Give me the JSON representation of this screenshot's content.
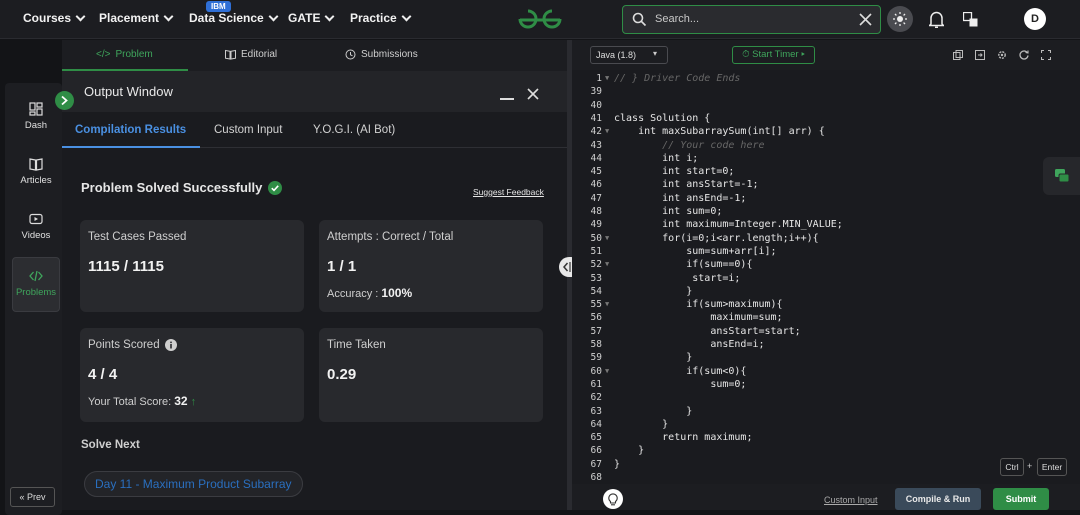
{
  "nav": {
    "items": [
      {
        "label": "Courses"
      },
      {
        "label": "Placement"
      },
      {
        "label": "Data Science"
      },
      {
        "label": "GATE"
      },
      {
        "label": "Practice"
      }
    ],
    "ibm_badge": "IBM",
    "search_placeholder": "Search...",
    "avatar_letter": "D"
  },
  "rail": {
    "items": [
      {
        "label": "Dash",
        "icon": "dashboard-icon"
      },
      {
        "label": "Articles",
        "icon": "book-icon"
      },
      {
        "label": "Videos",
        "icon": "video-icon"
      },
      {
        "label": "Problems",
        "icon": "code-icon"
      }
    ],
    "prev_label": "Prev"
  },
  "problem_tabs": [
    {
      "label": "Problem"
    },
    {
      "label": "Editorial"
    },
    {
      "label": "Submissions"
    }
  ],
  "output": {
    "title": "Output Window",
    "tabs": [
      {
        "label": "Compilation Results"
      },
      {
        "label": "Custom Input"
      },
      {
        "label": "Y.O.G.I. (AI Bot)"
      }
    ],
    "status": "Problem Solved Successfully",
    "feedback_link": "Suggest Feedback",
    "cards": {
      "test_cases": {
        "label": "Test Cases Passed",
        "value": "1115 / 1115"
      },
      "attempts": {
        "label": "Attempts : Correct / Total",
        "value": "1 / 1",
        "accuracy_label": "Accuracy :",
        "accuracy_value": "100%"
      },
      "points": {
        "label": "Points Scored",
        "value": "4 / 4",
        "total_label": "Your Total Score:",
        "total_value": "32"
      },
      "time": {
        "label": "Time Taken",
        "value": "0.29"
      }
    },
    "solve_next_label": "Solve Next",
    "solve_next_item": "Day 11 - Maximum Product Subarray"
  },
  "editor": {
    "language": "Java (1.8)",
    "timer_label": "Start Timer",
    "lines": [
      {
        "n": "1",
        "code": "// } Driver Code Ends",
        "comment": true
      },
      {
        "n": "39",
        "code": ""
      },
      {
        "n": "40",
        "code": ""
      },
      {
        "n": "41",
        "code": "class Solution {"
      },
      {
        "n": "42",
        "code": "    int maxSubarraySum(int[] arr) {"
      },
      {
        "n": "43",
        "code": "        // Your code here",
        "comment": true
      },
      {
        "n": "44",
        "code": "        int i;"
      },
      {
        "n": "45",
        "code": "        int start=0;"
      },
      {
        "n": "46",
        "code": "        int ansStart=-1;"
      },
      {
        "n": "47",
        "code": "        int ansEnd=-1;"
      },
      {
        "n": "48",
        "code": "        int sum=0;"
      },
      {
        "n": "49",
        "code": "        int maximum=Integer.MIN_VALUE;"
      },
      {
        "n": "50",
        "code": "        for(i=0;i<arr.length;i++){"
      },
      {
        "n": "51",
        "code": "            sum=sum+arr[i];"
      },
      {
        "n": "52",
        "code": "            if(sum==0){"
      },
      {
        "n": "53",
        "code": "             start=i;"
      },
      {
        "n": "54",
        "code": "            }"
      },
      {
        "n": "55",
        "code": "            if(sum>maximum){"
      },
      {
        "n": "56",
        "code": "                maximum=sum;"
      },
      {
        "n": "57",
        "code": "                ansStart=start;"
      },
      {
        "n": "58",
        "code": "                ansEnd=i;"
      },
      {
        "n": "59",
        "code": "            }"
      },
      {
        "n": "60",
        "code": "            if(sum<0){"
      },
      {
        "n": "61",
        "code": "                sum=0;"
      },
      {
        "n": "62",
        "code": ""
      },
      {
        "n": "63",
        "code": "            }"
      },
      {
        "n": "64",
        "code": "        }"
      },
      {
        "n": "65",
        "code": "        return maximum;"
      },
      {
        "n": "66",
        "code": "    }"
      },
      {
        "n": "67",
        "code": "}"
      },
      {
        "n": "68",
        "code": ""
      }
    ],
    "kbd_ctrl": "Ctrl",
    "kbd_plus": "+",
    "kbd_enter": "Enter",
    "custom_input": "Custom Input",
    "compile_label": "Compile & Run",
    "submit_label": "Submit"
  },
  "colors": {
    "brand_green": "#2f8d46",
    "link_blue": "#4a90e2"
  }
}
